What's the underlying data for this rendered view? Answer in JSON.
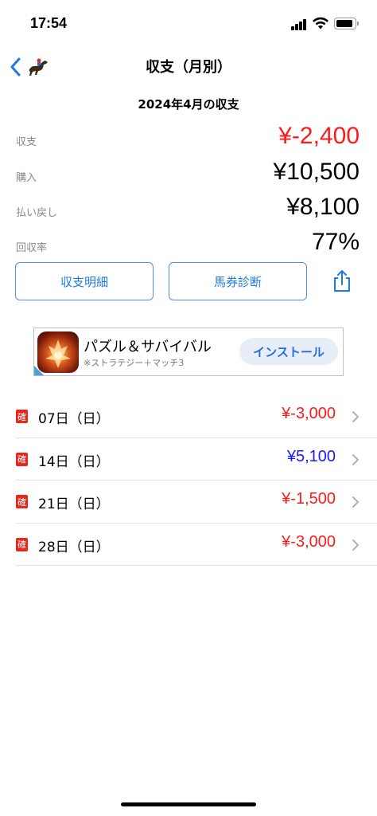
{
  "status_bar": {
    "time": "17:54"
  },
  "nav": {
    "title": "収支（月別）"
  },
  "period_title": "2024年4月の収支",
  "stats": [
    {
      "label": "収支",
      "value": "¥-2,400",
      "color": "#ff1a1a"
    },
    {
      "label": "購入",
      "value": "¥10,500",
      "color": "#000000"
    },
    {
      "label": "払い戻し",
      "value": "¥8,100",
      "color": "#000000"
    },
    {
      "label": "回収率",
      "value": "77%",
      "color": "#000000"
    }
  ],
  "buttons": {
    "detail": "収支明細",
    "diagnosis": "馬券診断",
    "share_icon": "share-icon"
  },
  "ad": {
    "title": "パズル＆サバイバル",
    "subtitle": "※ストラテジー＋マッチ3",
    "install": "インストール"
  },
  "days": [
    {
      "badge": "確",
      "label": "07日（日）",
      "amount": "¥-3,000",
      "color": "#ff1a1a"
    },
    {
      "badge": "確",
      "label": "14日（日）",
      "amount": "¥5,100",
      "color": "#1a1aff"
    },
    {
      "badge": "確",
      "label": "21日（日）",
      "amount": "¥-1,500",
      "color": "#ff1a1a"
    },
    {
      "badge": "確",
      "label": "28日（日）",
      "amount": "¥-3,000",
      "color": "#ff1a1a"
    }
  ]
}
